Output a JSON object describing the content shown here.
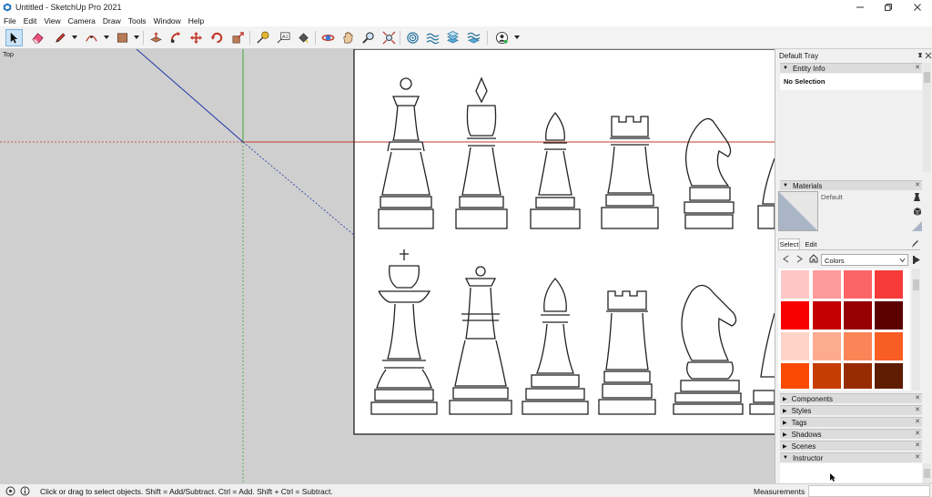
{
  "window": {
    "title": "Untitled - SketchUp Pro 2021"
  },
  "menu": [
    "File",
    "Edit",
    "View",
    "Camera",
    "Draw",
    "Tools",
    "Window",
    "Help"
  ],
  "toolbar": {
    "tools": [
      "select-tool",
      "eraser-tool",
      "pencil-tool",
      "arc-tool",
      "shape-tool",
      "paint-bucket-tool",
      "push-pull-tool",
      "move-tool",
      "rotate-tool",
      "scale-tool",
      "tape-measure-tool",
      "text-tool",
      "orbit-tool",
      "pan-tool",
      "zoom-tool",
      "zoom-extents-tool",
      "sandbox-1-tool",
      "sandbox-2-tool",
      "sandbox-3-tool",
      "sandbox-4-tool",
      "profile-tool"
    ]
  },
  "viewport": {
    "view_label": "Top"
  },
  "tray": {
    "title": "Default Tray",
    "entity_info": {
      "header": "Entity Info",
      "selection": "No Selection"
    },
    "materials": {
      "header": "Materials",
      "material_name": "Default",
      "tabs": [
        "Select",
        "Edit"
      ],
      "collection": "Colors",
      "swatches": [
        "#fdc7c7",
        "#fd9a9a",
        "#fc6565",
        "#f63a3a",
        "#f90000",
        "#c50000",
        "#970000",
        "#5d0000",
        "#fdd4c7",
        "#fdab90",
        "#fc8557",
        "#f85e23",
        "#fb4a04",
        "#c63d03",
        "#972c02",
        "#5e1c01"
      ]
    },
    "panels": [
      "Components",
      "Styles",
      "Tags",
      "Shadows",
      "Scenes",
      "Instructor"
    ]
  },
  "status": {
    "text": "Click or drag to select objects. Shift = Add/Subtract. Ctrl = Add. Shift + Ctrl = Subtract.",
    "measurements_label": "Measurements"
  },
  "colors": {
    "axis_red": "#c0392b",
    "axis_green": "#3aa63a",
    "axis_blue": "#2238a8",
    "selection_blue": "#cce4f7"
  }
}
